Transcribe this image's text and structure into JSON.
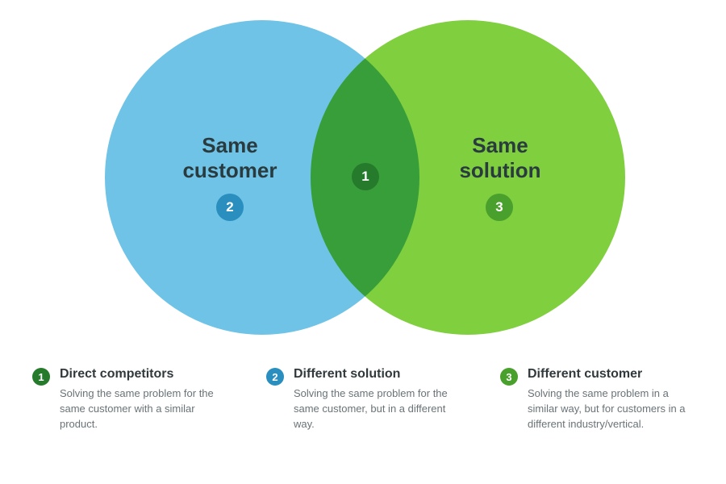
{
  "venn": {
    "left_label": "Same\ncustomer",
    "right_label": "Same\nsolution",
    "badges": {
      "center": {
        "num": "1",
        "color": "#267a2c"
      },
      "left": {
        "num": "2",
        "color": "#2a8fbf"
      },
      "right": {
        "num": "3",
        "color": "#4aa02c"
      }
    }
  },
  "legend": [
    {
      "num": "1",
      "color": "#267a2c",
      "title": "Direct competitors",
      "desc": "Solving the same problem for the same customer with a similar product."
    },
    {
      "num": "2",
      "color": "#2a8fbf",
      "title": "Different solution",
      "desc": "Solving the same problem for the same customer, but in a different way."
    },
    {
      "num": "3",
      "color": "#4aa02c",
      "title": "Different customer",
      "desc": "Solving the same problem in a similar way, but for customers in a different industry/vertical."
    }
  ]
}
